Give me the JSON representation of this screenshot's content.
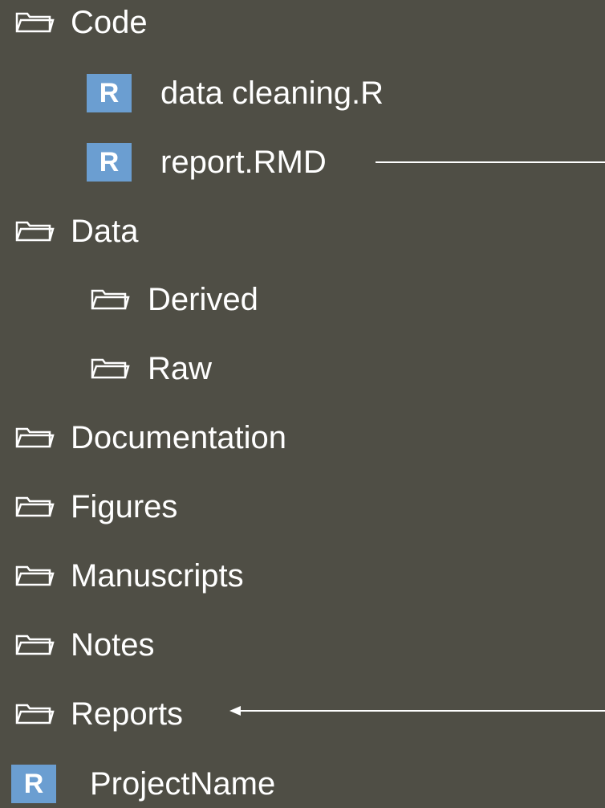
{
  "tree": {
    "code": {
      "label": "Code",
      "icon": "folder-icon"
    },
    "data_cleaning": {
      "label": "data cleaning.R",
      "badge": "R",
      "icon": "r-file-icon"
    },
    "report_rmd": {
      "label": "report.RMD",
      "badge": "R",
      "icon": "r-file-icon"
    },
    "data": {
      "label": "Data",
      "icon": "folder-icon"
    },
    "derived": {
      "label": "Derived",
      "icon": "folder-icon"
    },
    "raw": {
      "label": "Raw",
      "icon": "folder-icon"
    },
    "documentation": {
      "label": "Documentation",
      "icon": "folder-icon"
    },
    "figures": {
      "label": "Figures",
      "icon": "folder-icon"
    },
    "manuscripts": {
      "label": "Manuscripts",
      "icon": "folder-icon"
    },
    "notes": {
      "label": "Notes",
      "icon": "folder-icon"
    },
    "reports": {
      "label": "Reports",
      "icon": "folder-icon"
    },
    "project_name": {
      "label": "ProjectName",
      "badge": "R",
      "icon": "r-project-icon"
    }
  },
  "colors": {
    "background": "#4f4e45",
    "text": "#ffffff",
    "r_badge": "#6b9ed1"
  }
}
